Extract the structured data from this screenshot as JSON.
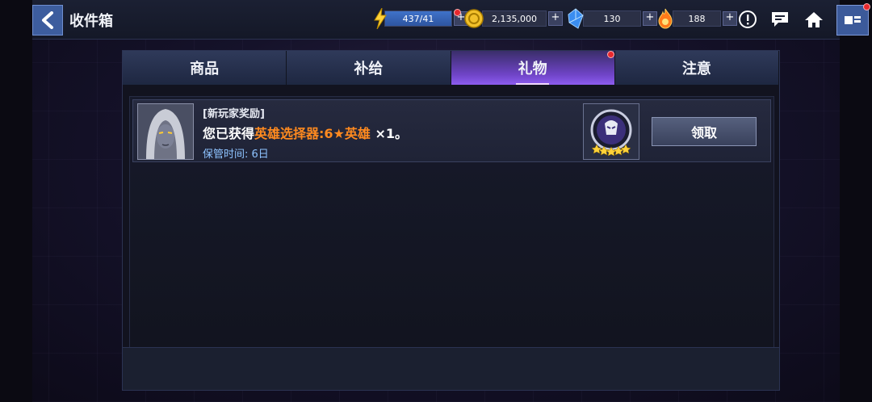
{
  "header": {
    "title": "收件箱",
    "resources": [
      {
        "name": "energy",
        "icon": "lightning-icon",
        "value": "437/41",
        "has_alert": true
      },
      {
        "name": "gold",
        "icon": "gold-coin-icon",
        "value": "2,135,000",
        "has_alert": false
      },
      {
        "name": "crystal",
        "icon": "blue-crystal-icon",
        "value": "130",
        "has_alert": false
      },
      {
        "name": "flame",
        "icon": "flame-orb-icon",
        "value": "188",
        "has_alert": false
      }
    ],
    "plus": "+"
  },
  "tabs": [
    {
      "label": "商品",
      "active": false,
      "alert": false
    },
    {
      "label": "补给",
      "active": false,
      "alert": false
    },
    {
      "label": "礼物",
      "active": true,
      "alert": true
    },
    {
      "label": "注意",
      "active": false,
      "alert": false
    }
  ],
  "mail": {
    "tag": "[新玩家奖励]",
    "prefix": "您已获得",
    "highlight": "英雄选择器:6★英雄",
    "suffix": "×1。",
    "expire": "保管时间: 6日",
    "claim_label": "领取",
    "item_icon": "hero-selector-icon",
    "item_stars": 5
  },
  "colors": {
    "accent_highlight": "#ff8a1f",
    "active_tab": "#6f44c7",
    "expire_text": "#8ec3ff"
  }
}
